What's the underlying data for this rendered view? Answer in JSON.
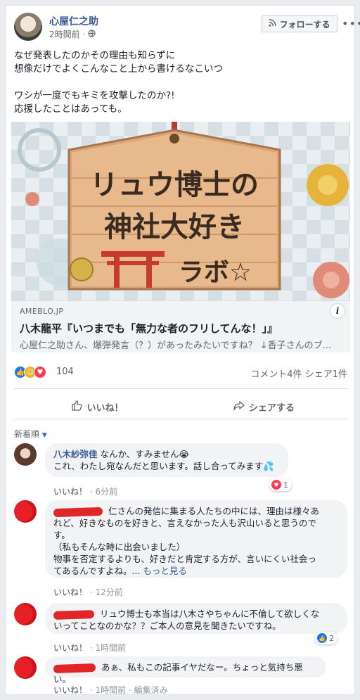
{
  "post": {
    "author": "心屋仁之助",
    "time": "2時間前",
    "follow_label": "フォローする",
    "more": "•••",
    "lines": [
      "なぜ発表したのかその理由も知らずに",
      "想像だけでよくこんなこと上から書けるなこいつ",
      "",
      "ワシが一度でもキミを攻撃したのか?!",
      "応援したことはあっても。"
    ]
  },
  "link": {
    "image_text_1": "リュウ博士の",
    "image_text_2": "神社大好き",
    "image_text_3": "ラボ☆",
    "domain": "AMEBLO.JP",
    "title": "八木龍平『いつまでも「無力な者のフリしてんな！」』",
    "description": "心屋仁之助さん、爆弾発言（？）があったみたいですね？ ↓香子さんのブ..."
  },
  "stats": {
    "reaction_count": "104",
    "comments": "コメント4件",
    "shares": "シェア1件"
  },
  "actions": {
    "like": "いいね！",
    "share": "シェアする"
  },
  "sort_label": "新着順",
  "comments": [
    {
      "name": "八木紗弥佳",
      "line1": "なんか、すみません😭",
      "line2": "これ、わたし宛なんだと思います。話し合ってみます💦",
      "like": "いいね！",
      "time": "6分前",
      "reaction": "1"
    },
    {
      "line1": "仁さんの発信に集まる人たちの中には、理由は様々あ",
      "line2": "れど、好きなものを好きと、言えなかった人も沢山いると思うので",
      "line3": "す。",
      "line4": "（私もそんな時に出会いました）",
      "line5": "物事を否定するよりも、好きだと肯定する方が、言いにくい社会っ",
      "line6": "てあるんですよね。...",
      "more": "もっと見る",
      "like": "いいね！",
      "time": "12分前"
    },
    {
      "line1": "リュウ博士も本当は八木さやちゃんに不倫して欲しくな",
      "line2": "いってことなのかな？？ご本人の意見を聞きたいですね。",
      "like": "いいね！",
      "time": "1時間前",
      "reaction": "2"
    },
    {
      "line1": "あぁ、私もこの記事イヤだなー。ちょっと気持ち悪い。",
      "like": "いいね！",
      "time": "1時間前",
      "edited": "編集済み"
    }
  ],
  "colors": {
    "link_blue": "#385898",
    "like_blue": "#1877f2",
    "scribble_red": "#e1262a"
  }
}
